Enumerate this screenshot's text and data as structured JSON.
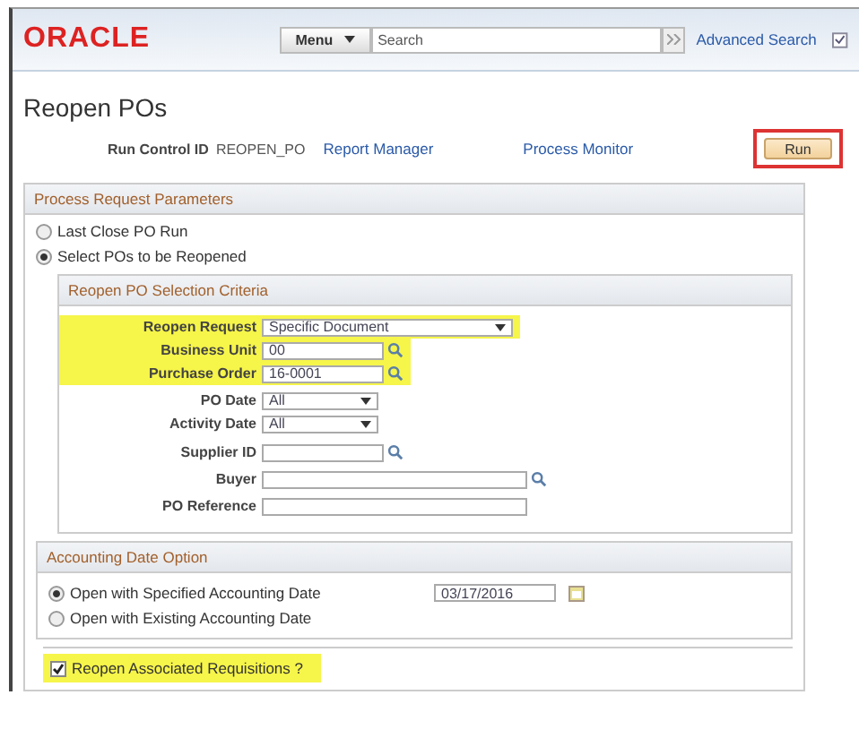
{
  "header": {
    "logo": "ORACLE",
    "menu": "Menu",
    "search": {
      "placeholder": "Search"
    },
    "advanced_search": "Advanced Search"
  },
  "page_title": "Reopen POs",
  "run_control": {
    "label": "Run Control ID",
    "value": "REOPEN_PO"
  },
  "links": [
    "Report Manager",
    "Process Monitor"
  ],
  "run_button": "Run",
  "parameters": {
    "title": "Process Request Parameters",
    "options": [
      {
        "label": "Last Close PO Run",
        "selected": false
      },
      {
        "label": "Select POs to be Reopened",
        "selected": true
      }
    ],
    "criteria": {
      "title": "Reopen PO Selection Criteria",
      "fields": [
        {
          "label": "Reopen Request",
          "kind": "dropdown",
          "value": "Specific Document",
          "highlighted": true
        },
        {
          "label": "Business Unit",
          "kind": "lookup",
          "value": "00",
          "highlighted": true
        },
        {
          "label": "Purchase Order",
          "kind": "lookup",
          "value": "16-0001",
          "highlighted": true
        },
        {
          "label": "PO Date",
          "kind": "dropdown",
          "value": "All",
          "highlighted": false
        },
        {
          "label": "Activity Date",
          "kind": "dropdown",
          "value": "All",
          "highlighted": false
        },
        {
          "label": "Supplier ID",
          "kind": "lookup",
          "highlighted": false
        },
        {
          "label": "Buyer",
          "kind": "lookup",
          "highlighted": false
        },
        {
          "label": "PO Reference",
          "kind": "text",
          "highlighted": false
        }
      ]
    }
  },
  "accounting": {
    "title": "Accounting Date Option",
    "options": [
      {
        "label": "Open with Specified Accounting Date",
        "selected": true,
        "date": "03/17/2016"
      },
      {
        "label": "Open with Existing Accounting Date",
        "selected": false
      }
    ]
  },
  "requisitions": {
    "label": "Reopen Associated Requisitions ?",
    "checked": true,
    "highlighted": true
  }
}
